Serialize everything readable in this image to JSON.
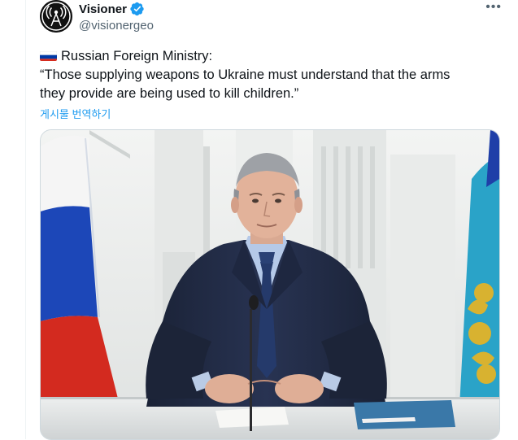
{
  "tweet": {
    "author": {
      "display_name": "Visioner",
      "handle": "@visionergeo",
      "verified": true,
      "avatar_icon": "satellite-antenna-logo"
    },
    "more_label": "•••",
    "text_lines": [
      "Russian Foreign Ministry:",
      "“Those supplying weapons to Ukraine must understand that the arms",
      "they provide are being used to kill children.”"
    ],
    "flag_icon": "russia-flag-emoji",
    "translate_label": "게시물 번역하기",
    "media": {
      "type": "photo",
      "subject": "man in dark suit at desk with microphone, Russian flag left, emblem flag right"
    }
  },
  "colors": {
    "link": "#1d9bf0",
    "secondary_text": "#536471",
    "verified": "#1d9bf0",
    "border": "#cfd9de"
  }
}
